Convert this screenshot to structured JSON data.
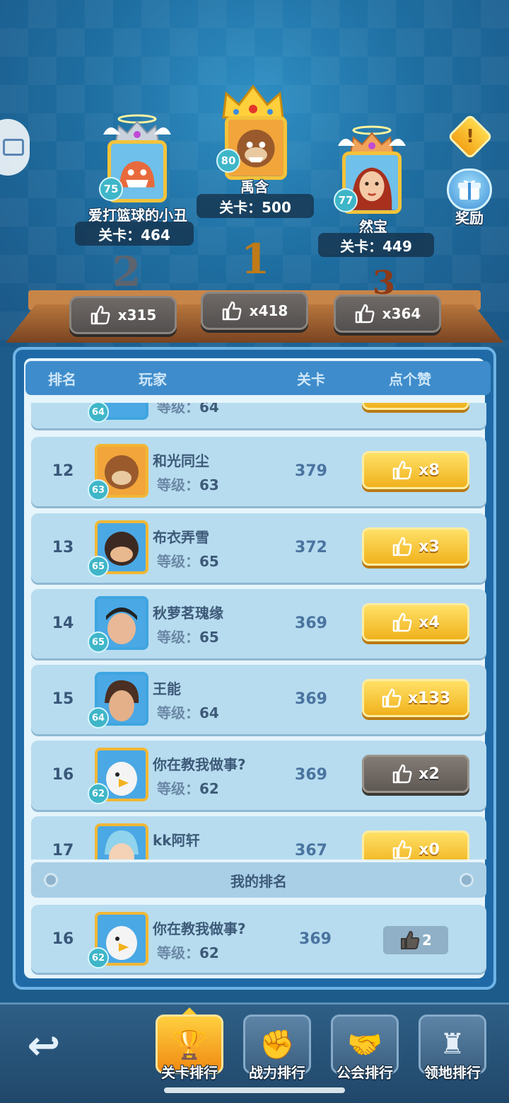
{
  "podium": {
    "first": {
      "name": "禹含",
      "level": "80",
      "stage_label": "关卡：500",
      "likes": "x418",
      "rank": "1"
    },
    "second": {
      "name": "爱打篮球的小丑",
      "level": "75",
      "stage_label": "关卡：464",
      "likes": "x315",
      "rank": "2"
    },
    "third": {
      "name": "然宝",
      "level": "77",
      "stage_label": "关卡：449",
      "likes": "x364",
      "rank": "3"
    }
  },
  "reward_label": "奖励",
  "info_icon": "!",
  "table_header": {
    "rank": "排名",
    "player": "玩家",
    "stage": "关卡",
    "likes": "点个赞"
  },
  "rows": [
    {
      "rank": "",
      "name": "",
      "level_label": "等级：",
      "level": "64",
      "stage": "",
      "likes": "",
      "badge": "64"
    },
    {
      "rank": "12",
      "name": "和光同尘",
      "level_label": "等级：",
      "level": "63",
      "stage": "379",
      "likes": "x8",
      "badge": "63"
    },
    {
      "rank": "13",
      "name": "布衣弄雪",
      "level_label": "等级：",
      "level": "65",
      "stage": "372",
      "likes": "x3",
      "badge": "65"
    },
    {
      "rank": "14",
      "name": "秋萝茗瑰缘",
      "level_label": "等级：",
      "level": "65",
      "stage": "369",
      "likes": "x4",
      "badge": "65"
    },
    {
      "rank": "15",
      "name": "王能",
      "level_label": "等级：",
      "level": "64",
      "stage": "369",
      "likes": "x133",
      "badge": "64"
    },
    {
      "rank": "16",
      "name": "你在教我做事?",
      "level_label": "等级：",
      "level": "62",
      "stage": "369",
      "likes": "x2",
      "badge": "62"
    },
    {
      "rank": "17",
      "name": "kk阿轩",
      "level_label": "等级：",
      "level": "",
      "stage": "367",
      "likes": "x0",
      "badge": ""
    }
  ],
  "my_rank_title": "我的排名",
  "my_row": {
    "rank": "16",
    "name": "你在教我做事?",
    "level_label": "等级：",
    "level": "62",
    "stage": "369",
    "likes": "2",
    "badge": "62"
  },
  "tabs": [
    {
      "label": "关卡排行",
      "icon": "trophy-icon"
    },
    {
      "label": "战力排行",
      "icon": "fist-trophy-icon"
    },
    {
      "label": "公会排行",
      "icon": "handshake-trophy-icon"
    },
    {
      "label": "领地排行",
      "icon": "castle-tower-icon"
    }
  ],
  "colors": {
    "gold": "#f0b21d",
    "grey_button": "#5f5955",
    "panel_blue": "#1f6aa6",
    "row_blue": "#b7dcef"
  }
}
